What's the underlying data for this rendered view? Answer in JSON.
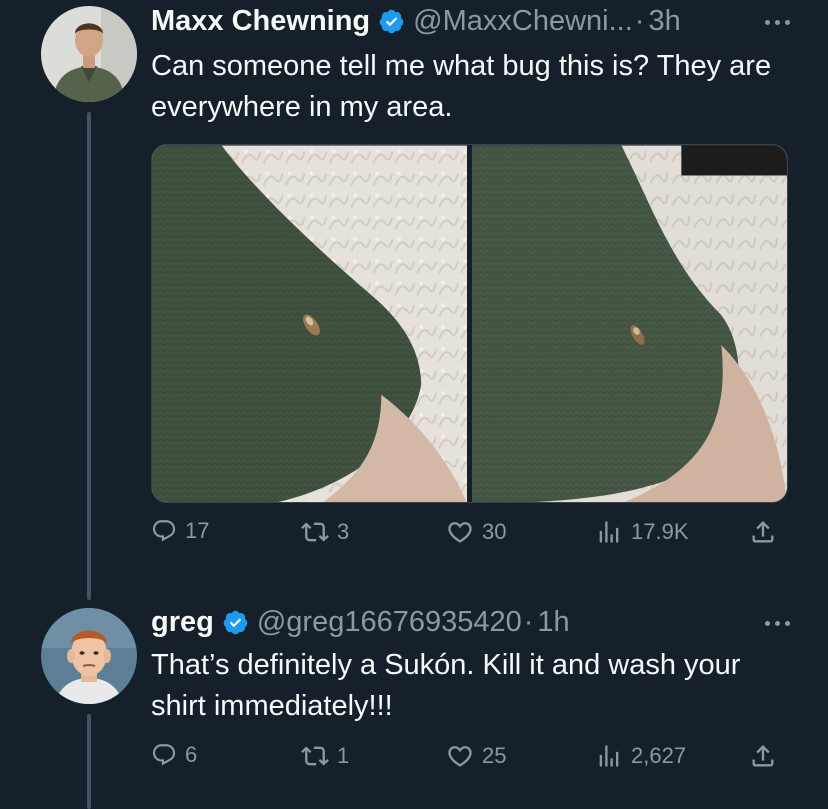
{
  "tweets": [
    {
      "name": "Maxx Chewning",
      "handle": "@MaxxChewni...",
      "separator": "·",
      "time": "3h",
      "text": "Can someone tell me what bug this is? They are everywhere in my area.",
      "stats": {
        "replies": "17",
        "retweets": "3",
        "likes": "30",
        "views": "17.9K"
      },
      "icons": [
        "verified-badge-icon",
        "more-icon",
        "reply-icon",
        "retweet-icon",
        "like-icon",
        "views-icon",
        "share-icon"
      ]
    },
    {
      "name": "greg",
      "handle": "@greg16676935420",
      "separator": "·",
      "time": "1h",
      "text": "That’s definitely a Sukón. Kill it and wash your shirt immediately!!!",
      "stats": {
        "replies": "6",
        "retweets": "1",
        "likes": "25",
        "views": "2,627"
      },
      "icons": [
        "verified-badge-icon",
        "more-icon",
        "reply-icon",
        "retweet-icon",
        "like-icon",
        "views-icon",
        "share-icon"
      ]
    }
  ],
  "colors": {
    "background": "#15202b",
    "text_primary": "#f7f9f9",
    "text_secondary": "#8b98a5",
    "verified_blue": "#1d9bf0",
    "thread_line": "#425364"
  }
}
